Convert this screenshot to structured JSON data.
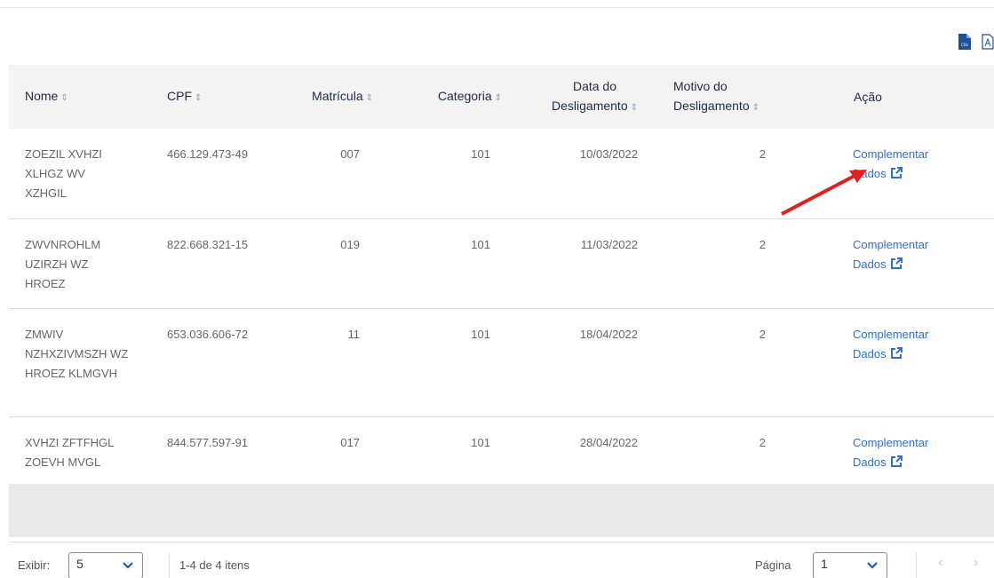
{
  "export": {
    "csv_icon": "csv-icon",
    "pdf_icon": "pdf-icon"
  },
  "table": {
    "headers": {
      "nome": "Nome",
      "cpf": "CPF",
      "matricula": "Matrícula",
      "categoria": "Categoria",
      "data_line1": "Data do",
      "data_line2": "Desligamento",
      "motivo_line1": "Motivo do",
      "motivo_line2": "Desligamento",
      "acao": "Ação"
    },
    "sort_glyph": "⇕",
    "rows": [
      {
        "nome": "ZOEZIL XVHZI XLHGZ WV XZHGIL",
        "cpf": "466.129.473-49",
        "matricula": "007",
        "categoria": "101",
        "data": "10/03/2022",
        "motivo": "2",
        "acao_line1": "Complementar",
        "acao_line2": "Dados"
      },
      {
        "nome": "ZWVNROHLM UZIRZH WZ HROEZ",
        "cpf": "822.668.321-15",
        "matricula": "019",
        "categoria": "101",
        "data": "11/03/2022",
        "motivo": "2",
        "acao_line1": "Complementar",
        "acao_line2": "Dados"
      },
      {
        "nome": "ZMWIV NZHXZIVMSZH WZ HROEZ KLMGVH",
        "cpf": "653.036.606-72",
        "matricula": "11",
        "categoria": "101",
        "data": "18/04/2022",
        "motivo": "2",
        "acao_line1": "Complementar",
        "acao_line2": "Dados"
      },
      {
        "nome": "XVHZI ZFTFHGL ZOEVH MVGL",
        "cpf": "844.577.597-91",
        "matricula": "017",
        "categoria": "101",
        "data": "28/04/2022",
        "motivo": "2",
        "acao_line1": "Complementar",
        "acao_line2": "Dados"
      }
    ]
  },
  "footer": {
    "exibir_label": "Exibir:",
    "page_size": "5",
    "items_text": "1-4 de 4 itens",
    "pagina_label": "Página",
    "page_number": "1",
    "prev": "‹",
    "next": "›"
  },
  "colors": {
    "link": "#2e6fcf",
    "header_bg": "#f3f3f3",
    "arrow": "#e02020"
  }
}
